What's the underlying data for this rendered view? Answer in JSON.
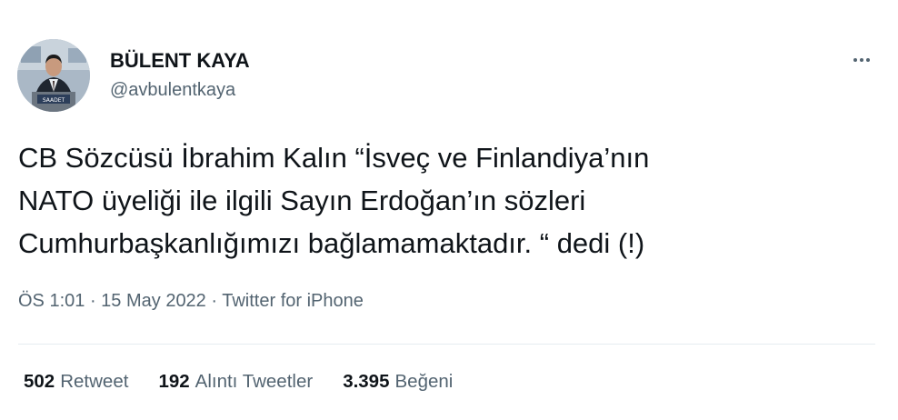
{
  "author": {
    "name": "BÜLENT KAYA",
    "handle": "@avbulentkaya",
    "avatar_banner_text": "SAADET"
  },
  "tweet": {
    "lines": [
      "CB Sözcüsü İbrahim Kalın “İsveç ve Finlandiya’nın",
      "NATO üyeliği ile ilgili Sayın Erdoğan’ın sözleri",
      "Cumhurbaşkanlığımızı bağlamamaktadır. “ dedi (!)"
    ],
    "time": "ÖS 1:01",
    "separator": "·",
    "date": "15 May 2022",
    "source": "Twitter for iPhone"
  },
  "stats": {
    "retweets_count": "502",
    "retweets_label": "Retweet",
    "quotes_count": "192",
    "quotes_label": "Alıntı Tweetler",
    "likes_count": "3.395",
    "likes_label": "Beğeni"
  },
  "icons": {
    "more": "more-horizontal-icon"
  },
  "colors": {
    "primary_text": "#0f1419",
    "secondary_text": "#536471",
    "divider": "#e6ecf0"
  }
}
